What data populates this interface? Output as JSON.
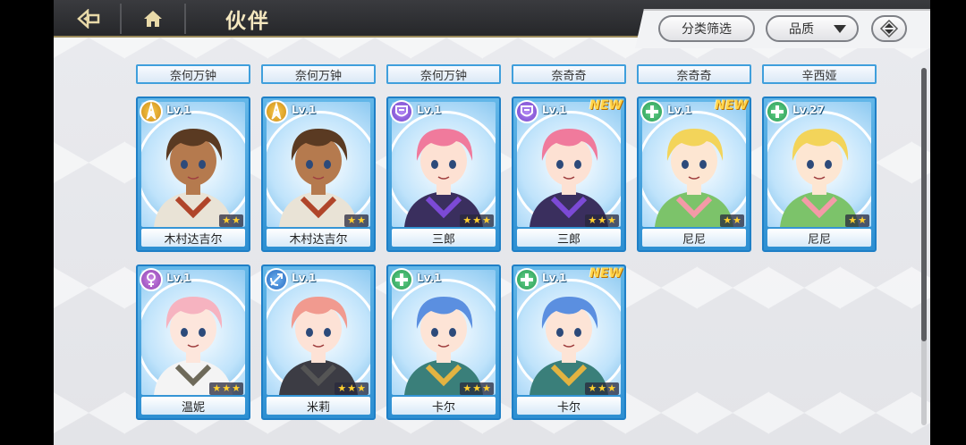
{
  "header": {
    "title": "伙伴",
    "filter_label": "分类筛选",
    "quality_label": "品质"
  },
  "icons": {
    "back": "back-arrow-icon",
    "home": "home-icon",
    "sort": "sort-updown-icon",
    "caret": "caret-down-icon"
  },
  "tags": [
    "奈何万钟",
    "奈何万钟",
    "奈何万钟",
    "奈奇奇",
    "奈奇奇",
    "辛西娅"
  ],
  "cards": [
    {
      "name": "木村达吉尔",
      "level": "Lv.1",
      "role": "gold",
      "stars": 2,
      "is_new": false,
      "new_label": ""
    },
    {
      "name": "木村达吉尔",
      "level": "Lv.1",
      "role": "gold",
      "stars": 2,
      "is_new": false,
      "new_label": ""
    },
    {
      "name": "三郎",
      "level": "Lv.1",
      "role": "purple",
      "stars": 3,
      "is_new": false,
      "new_label": ""
    },
    {
      "name": "三郎",
      "level": "Lv.1",
      "role": "purple",
      "stars": 3,
      "is_new": true,
      "new_label": "NEW"
    },
    {
      "name": "尼尼",
      "level": "Lv.1",
      "role": "green",
      "stars": 2,
      "is_new": true,
      "new_label": "NEW"
    },
    {
      "name": "尼尼",
      "level": "Lv.27",
      "role": "green",
      "stars": 2,
      "is_new": false,
      "new_label": ""
    },
    {
      "name": "温妮",
      "level": "Lv.1",
      "role": "violet",
      "stars": 3,
      "is_new": false,
      "new_label": ""
    },
    {
      "name": "米莉",
      "level": "Lv.1",
      "role": "blue",
      "stars": 3,
      "is_new": false,
      "new_label": ""
    },
    {
      "name": "卡尔",
      "level": "Lv.1",
      "role": "green",
      "stars": 3,
      "is_new": false,
      "new_label": ""
    },
    {
      "name": "卡尔",
      "level": "Lv.1",
      "role": "green",
      "stars": 3,
      "is_new": true,
      "new_label": "NEW"
    }
  ],
  "colors": {
    "card_border": "#1e7fc6",
    "card_bg": "#2d8fd2",
    "topbar": "#26272a",
    "title_text": "#f4e7bf",
    "new_badge": "#ffd44a",
    "star": "#ffcf2e"
  }
}
